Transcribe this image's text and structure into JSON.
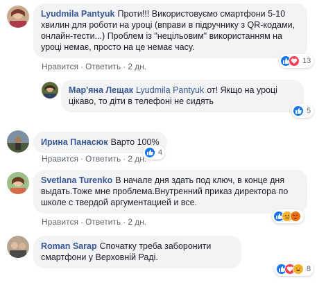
{
  "comments": [
    {
      "author": "Lyudmila Pantyuk",
      "text": "Проти!!! Використовуємо смартфони 5-10 хвилин для роботи на уроці (вправи в підручнику з QR-кодами, онлайн-тести...) Проблем із \"нецільовим\" використанням на уроці немає, просто на це немає часу.",
      "like": "Нравится",
      "reply": "Ответить",
      "time": "2 дн.",
      "reactions": [
        "like-icon",
        "love-icon"
      ],
      "count": "13"
    },
    {
      "author": "Мар'яна Лещак",
      "mention": "Lyudmila Pantyuk",
      "text": "от! Якщо на уроці цікаво, то діти в телефоні не сидять",
      "like": "Нравится",
      "reply": "Ответить",
      "time": "2 дн.",
      "reactions": [
        "like-icon"
      ],
      "count": "5"
    },
    {
      "author": "Ирина Панасюк",
      "text": "Варто 100%",
      "like": "Нравится",
      "reply": "Ответить",
      "time": "2 дн.",
      "reactions": [
        "like-icon"
      ],
      "count": "4"
    },
    {
      "author": "Svetlana Turenko",
      "text": "В начале дня здать под ключ, в конце дня выдать.Тоже мне проблема.Внутренний приказ директора по школе с твердой аргументацией и все.",
      "like": "Нравится",
      "reply": "Ответить",
      "time": "2 дн.",
      "reactions": [
        "like-icon",
        "sad-icon",
        "angry-icon"
      ],
      "count": "6"
    },
    {
      "author": "Roman Sarap",
      "text": "Спочатку треба заборонити смартфони у Верховній Раді.",
      "like": "Нравится",
      "reply": "Ответить",
      "time": "2 дн.",
      "reactions": [
        "like-icon",
        "love-icon",
        "haha-icon"
      ],
      "count": "8"
    }
  ],
  "sep": "·",
  "colors": {
    "link": "#385898",
    "bubble": "#f2f3f5",
    "like": "#1877f2",
    "love": "#f33e58",
    "haha": "#f7b125",
    "angry": "#e9710f"
  }
}
